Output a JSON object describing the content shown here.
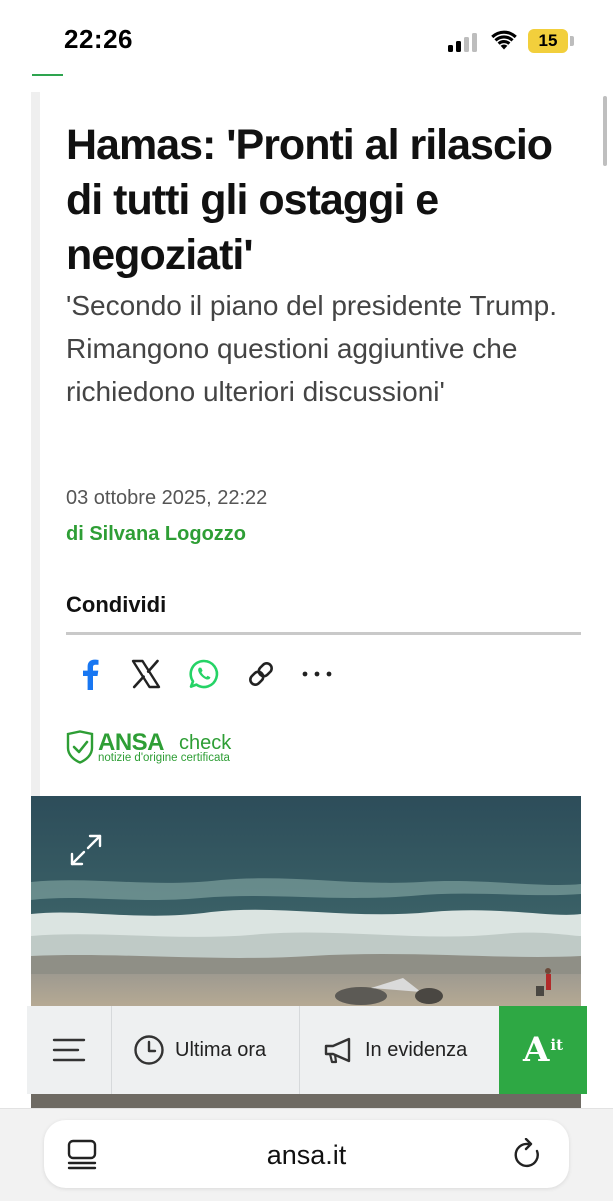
{
  "status_bar": {
    "time": "22:26",
    "battery_level": "15",
    "colors": {
      "battery": "#f2cf3c"
    }
  },
  "article": {
    "headline": "Hamas: 'Pronti al rilascio di tutti gli ostaggi e negoziati'",
    "subtitle": "'Secondo il piano del presidente Trump. Rimangono questioni aggiuntive che richiedono ulteriori discussioni'",
    "date": "03 ottobre 2025, 22:22",
    "author": "di Silvana Logozzo",
    "share_label": "Condividi",
    "share_icons": [
      "facebook-icon",
      "x-icon",
      "whatsapp-icon",
      "link-icon",
      "more-icon"
    ],
    "ansa_check": {
      "brand": "ANSA",
      "suffix": "check",
      "tagline": "notizie d'origine certificata"
    },
    "colors": {
      "accent_green": "#2e9e35",
      "facebook": "#1877f2",
      "whatsapp": "#25d366"
    }
  },
  "section_nav": {
    "menu_icon": "hamburger-menu-icon",
    "ultima_ora": "Ultima ora",
    "in_evidenza": "In evidenza",
    "brand_logo": {
      "a": "A",
      "it": "it"
    }
  },
  "browser": {
    "url": "ansa.it"
  }
}
